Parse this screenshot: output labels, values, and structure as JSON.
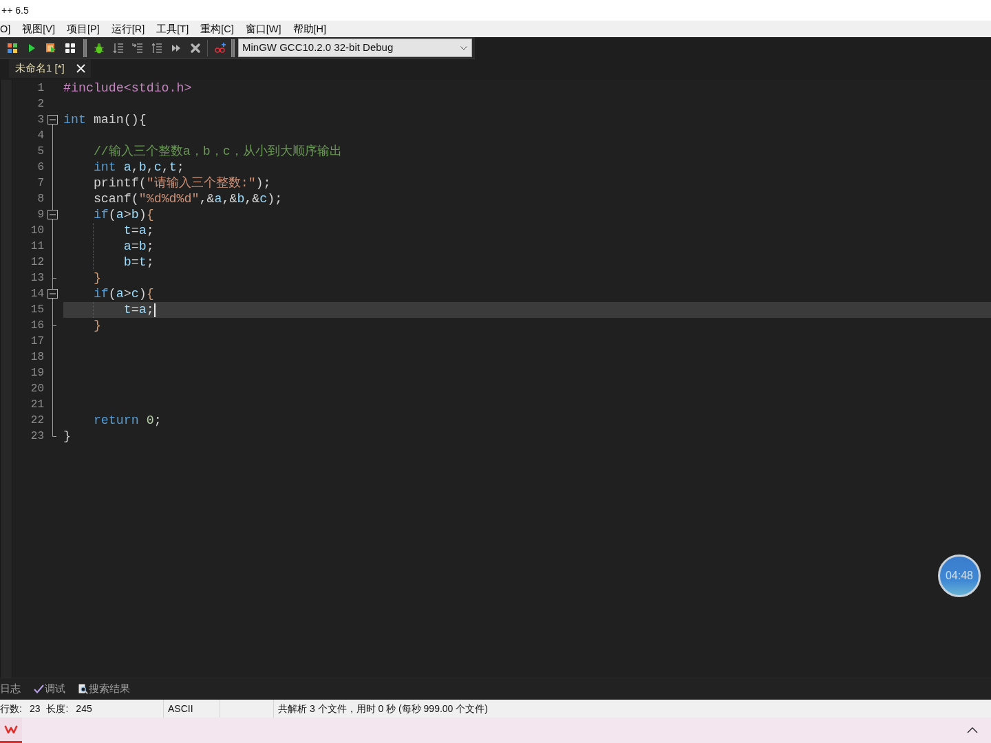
{
  "window": {
    "title": "++ 6.5"
  },
  "menu_bar": [
    "O]",
    "视图[V]",
    "项目[P]",
    "运行[R]",
    "工具[T]",
    "重构[C]",
    "窗口[W]",
    "帮助[H]"
  ],
  "toolbar": {
    "compiler_select": {
      "value": "MinGW GCC10.2.0 32-bit Debug"
    }
  },
  "tabs": [
    {
      "label": "未命名1 [*]",
      "selected": true
    }
  ],
  "editor": {
    "lines": [
      {
        "number": "1",
        "kind": "code",
        "current": false,
        "tokens": [
          {
            "text": "#include<stdio.h>",
            "kind": "preprocessor"
          }
        ]
      },
      {
        "number": "2",
        "kind": "code",
        "current": false
      },
      {
        "number": "3",
        "kind": "fold_start",
        "current": false,
        "tokens": [
          {
            "text": "int",
            "kind": "keyword"
          },
          {
            "text": " main(){",
            "kind": "plain"
          }
        ]
      },
      {
        "number": "4",
        "kind": "code",
        "current": false
      },
      {
        "number": "5",
        "kind": "code",
        "current": false,
        "tokens": [
          {
            "text": "    //输入三个整数a，b，c，从小到大顺序输出",
            "kind": "comment"
          }
        ]
      },
      {
        "number": "6",
        "kind": "code",
        "current": false,
        "tokens": [
          {
            "text": "    int",
            "kind": "keyword"
          },
          {
            "text": " a",
            "kind": "identifier"
          },
          {
            "text": ",",
            "kind": "plain"
          },
          {
            "text": "b",
            "kind": "identifier"
          },
          {
            "text": ",",
            "kind": "plain"
          },
          {
            "text": "c",
            "kind": "identifier"
          },
          {
            "text": ",",
            "kind": "plain"
          },
          {
            "text": "t",
            "kind": "identifier"
          },
          {
            "text": ";",
            "kind": "plain"
          }
        ]
      },
      {
        "number": "7",
        "kind": "code",
        "current": false,
        "tokens": [
          {
            "text": "    printf(",
            "kind": "plain"
          },
          {
            "text": "\"请输入三个整数:\"",
            "kind": "string"
          },
          {
            "text": ");",
            "kind": "plain"
          }
        ]
      },
      {
        "number": "8",
        "kind": "code",
        "current": false,
        "tokens": [
          {
            "text": "    scanf(",
            "kind": "plain"
          },
          {
            "text": "\"%d%d%d\"",
            "kind": "string"
          },
          {
            "text": ",&",
            "kind": "plain"
          },
          {
            "text": "a",
            "kind": "identifier"
          },
          {
            "text": ",&",
            "kind": "plain"
          },
          {
            "text": "b",
            "kind": "identifier"
          },
          {
            "text": ",&",
            "kind": "plain"
          },
          {
            "text": "c",
            "kind": "identifier"
          },
          {
            "text": ");",
            "kind": "plain"
          }
        ]
      },
      {
        "number": "9",
        "kind": "fold_start",
        "current": false,
        "tokens": [
          {
            "text": "    if",
            "kind": "keyword"
          },
          {
            "text": "(",
            "kind": "plain"
          },
          {
            "text": "a",
            "kind": "identifier"
          },
          {
            "text": ">",
            "kind": "plain"
          },
          {
            "text": "b",
            "kind": "identifier"
          },
          {
            "text": ")",
            "kind": "plain"
          },
          {
            "text": "{",
            "kind": "brace"
          }
        ]
      },
      {
        "number": "10",
        "kind": "code",
        "current": false,
        "tokens": [
          {
            "text": "        t",
            "kind": "identifier"
          },
          {
            "text": "=",
            "kind": "plain"
          },
          {
            "text": "a",
            "kind": "identifier"
          },
          {
            "text": ";",
            "kind": "plain"
          }
        ]
      },
      {
        "number": "11",
        "kind": "code",
        "current": false,
        "tokens": [
          {
            "text": "        a",
            "kind": "identifier"
          },
          {
            "text": "=",
            "kind": "plain"
          },
          {
            "text": "b",
            "kind": "identifier"
          },
          {
            "text": ";",
            "kind": "plain"
          }
        ]
      },
      {
        "number": "12",
        "kind": "code",
        "current": false,
        "tokens": [
          {
            "text": "        b",
            "kind": "identifier"
          },
          {
            "text": "=",
            "kind": "plain"
          },
          {
            "text": "t",
            "kind": "identifier"
          },
          {
            "text": ";",
            "kind": "plain"
          }
        ]
      },
      {
        "number": "13",
        "kind": "fold_end",
        "current": false,
        "tokens": [
          {
            "text": "    }",
            "kind": "brace"
          }
        ]
      },
      {
        "number": "14",
        "kind": "fold_start",
        "current": false,
        "tokens": [
          {
            "text": "    if",
            "kind": "keyword"
          },
          {
            "text": "(",
            "kind": "plain"
          },
          {
            "text": "a",
            "kind": "identifier"
          },
          {
            "text": ">",
            "kind": "plain"
          },
          {
            "text": "c",
            "kind": "identifier"
          },
          {
            "text": ")",
            "kind": "plain"
          },
          {
            "text": "{",
            "kind": "brace"
          }
        ]
      },
      {
        "number": "15",
        "kind": "code",
        "current": true,
        "tokens": [
          {
            "text": "        t",
            "kind": "identifier"
          },
          {
            "text": "=",
            "kind": "plain"
          },
          {
            "text": "a",
            "kind": "identifier"
          },
          {
            "text": ";",
            "kind": "plain"
          }
        ]
      },
      {
        "number": "16",
        "kind": "fold_end",
        "current": false,
        "tokens": [
          {
            "text": "    }",
            "kind": "brace"
          }
        ]
      },
      {
        "number": "17",
        "kind": "code",
        "current": false
      },
      {
        "number": "18",
        "kind": "code",
        "current": false
      },
      {
        "number": "19",
        "kind": "code",
        "current": false
      },
      {
        "number": "20",
        "kind": "code",
        "current": false
      },
      {
        "number": "21",
        "kind": "code",
        "current": false
      },
      {
        "number": "22",
        "kind": "code",
        "current": false,
        "tokens": [
          {
            "text": "    return",
            "kind": "keyword"
          },
          {
            "text": " 0",
            "kind": "number"
          },
          {
            "text": ";",
            "kind": "plain"
          }
        ]
      },
      {
        "number": "23",
        "kind": "fold_last",
        "current": false,
        "tokens": [
          {
            "text": "}",
            "kind": "plain"
          }
        ]
      }
    ]
  },
  "timer": {
    "text": "04:48"
  },
  "bottom_panel": {
    "tabs": [
      {
        "label": "日志",
        "kind": "log"
      },
      {
        "label": "调试",
        "kind": "debug"
      },
      {
        "label": "搜索结果",
        "kind": "search"
      }
    ]
  },
  "status_bar": {
    "line_count_label": "行数:",
    "line_count": "23",
    "length_label": "长度:",
    "length": "245",
    "encoding": "ASCII",
    "message": "共解析 3 个文件，用时 0 秒 (每秒 999.00 个文件)"
  }
}
